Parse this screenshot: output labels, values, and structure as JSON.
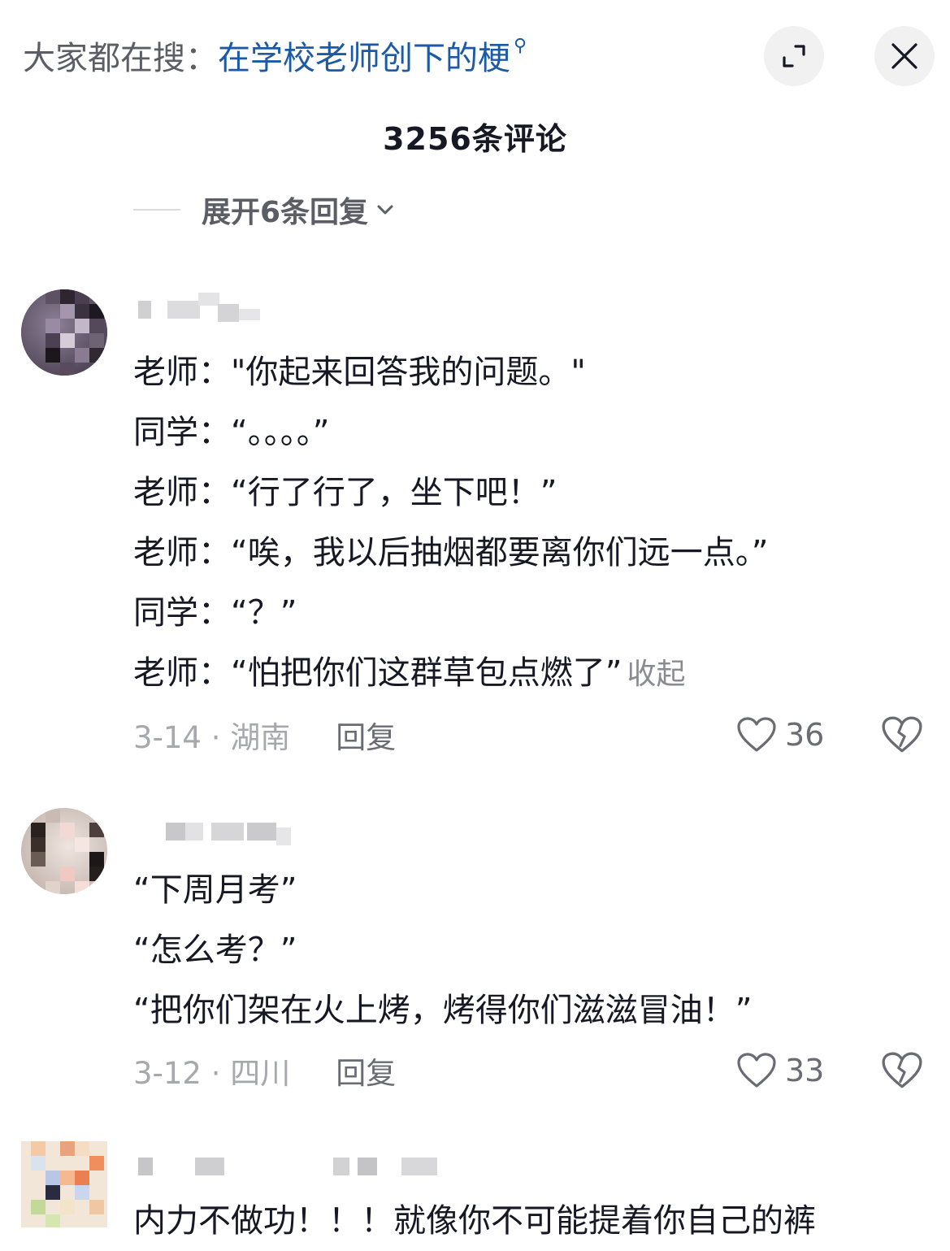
{
  "search": {
    "prefix": "大家都在搜：",
    "keyword": "在学校老师创下的梗",
    "glyph": "⚲"
  },
  "header": {
    "comment_count_title": "3256条评论"
  },
  "expand_replies": {
    "label": "展开6条回复"
  },
  "comments": [
    {
      "lines": [
        "老师：\"你起来回答我的问题。\"",
        "同学：“。。。。”",
        "老师：“行了行了，坐下吧！”",
        "老师：“唉，我以后抽烟都要离你们远一点。”",
        "同学：“？”",
        "老师：“怕把你们这群草包点燃了”"
      ],
      "collapse_label": "收起",
      "date_location": "3-14 · 湖南",
      "reply_label": "回复",
      "likes": "36"
    },
    {
      "lines": [
        "“下周月考”",
        "“怎么考？”",
        "“把你们架在火上烤，烤得你们滋滋冒油！”"
      ],
      "date_location": "3-12 · 四川",
      "reply_label": "回复",
      "likes": "33"
    },
    {
      "lines": [
        "内力不做功！！！就像你不可能提着你自己的裤"
      ]
    }
  ],
  "icons": {
    "expand": "expand-icon",
    "close": "close-icon",
    "chevron": "chevron-down-icon",
    "like": "heart-outline-icon",
    "dislike": "broken-heart-icon"
  },
  "colors": {
    "keyword": "#1c5aa6",
    "text": "#161823",
    "muted": "#a7a8ad",
    "button_bg": "#f1f1f2"
  }
}
